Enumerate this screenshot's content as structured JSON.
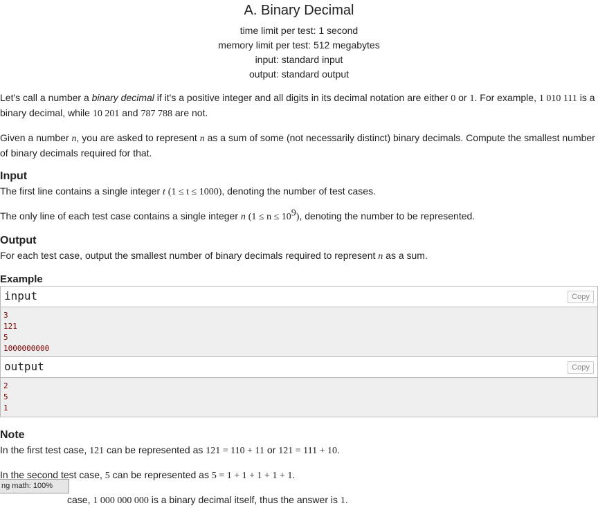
{
  "problem": {
    "title": "A. Binary Decimal",
    "limits": [
      "time limit per test: 1 second",
      "memory limit per test: 512 megabytes",
      "input: standard input",
      "output: standard output"
    ]
  },
  "statement": {
    "p1_a": "Let's call a number a ",
    "p1_em": "binary decimal",
    "p1_b": " if it's a positive integer and all digits in its decimal notation are either ",
    "p1_zero": "0",
    "p1_or": " or ",
    "p1_one": "1",
    "p1_c": ". For example, ",
    "p1_ex1": "1 010 111",
    "p1_d": " is a binary decimal, while ",
    "p1_ex2": "10 201",
    "p1_and": " and ",
    "p1_ex3": "787 788",
    "p1_e": " are not.",
    "p2_a": "Given a number ",
    "p2_n1": "n",
    "p2_b": ", you are asked to represent ",
    "p2_n2": "n",
    "p2_c": " as a sum of some (not necessarily distinct) binary decimals. Compute the smallest number of binary decimals required for that."
  },
  "input_section": {
    "heading": "Input",
    "line1_a": "The first line contains a single integer ",
    "line1_t": "t",
    "line1_math": "(1 ≤ t ≤ 1000)",
    "line1_b": ", denoting the number of test cases.",
    "line2_a": "The only line of each test case contains a single integer ",
    "line2_n": "n",
    "line2_math": "(1 ≤ n ≤ 10",
    "line2_sup": "9",
    "line2_close": ")",
    "line2_b": ", denoting the number to be represented."
  },
  "output_section": {
    "heading": "Output",
    "line_a": "For each test case, output the smallest number of binary decimals required to represent ",
    "line_n": "n",
    "line_b": " as a sum."
  },
  "example": {
    "heading": "Example",
    "input_label": "input",
    "output_label": "output",
    "copy_label": "Copy",
    "input_lines": [
      "3",
      "121",
      "5",
      "1000000000"
    ],
    "output_lines": [
      "2",
      "5",
      "1"
    ]
  },
  "note": {
    "heading": "Note",
    "l1_a": "In the first test case, ",
    "l1_v": "121",
    "l1_b": " can be represented as ",
    "l1_e1": "121 = 110 + 11",
    "l1_or": " or ",
    "l1_e2": "121 = 111 + 10",
    "l1_end": ".",
    "l2_a": "In the second test case, ",
    "l2_v": "5",
    "l2_b": " can be represented as ",
    "l2_e": "5 = 1 + 1 + 1 + 1 + 1",
    "l2_end": ".",
    "l3_a": "case, ",
    "l3_v": "1 000 000 000",
    "l3_b": " is a binary decimal itself, thus the answer is ",
    "l3_ans": "1",
    "l3_end": "."
  },
  "zoom_badge": "ng math: 100%"
}
